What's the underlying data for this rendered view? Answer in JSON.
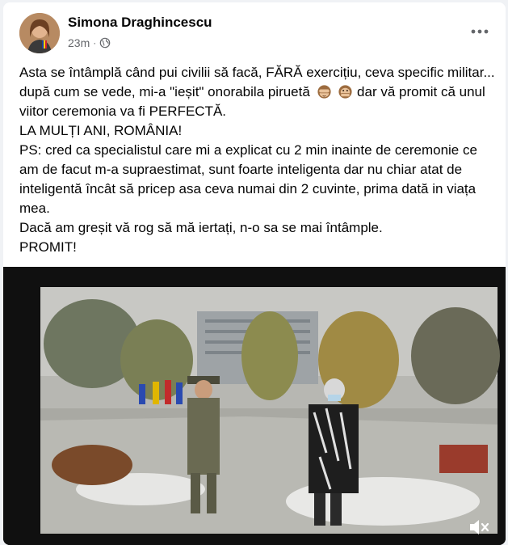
{
  "post": {
    "author": "Simona Draghincescu",
    "time": "23m",
    "separator": "·",
    "paragraphs": [
      {
        "text": "Asta se întâmplă când  pui civilii să facă,   FĂRĂ exercițiu, ceva specific militar... după cum se vede, mi-a \"ieșit\" onorabila piruetă",
        "after": "dar vă promit că  unul viitor ceremonia va fi PERFECTĂ."
      },
      {
        "text": "LA MULȚI ANI, ROMÂNIA!"
      },
      {
        "text": "PS: cred ca specialistul care mi a explicat cu 2 min inainte de ceremonie ce am de facut m-a supraestimat, sunt foarte inteligenta dar nu chiar  atat de inteligentă încât să pricep asa ceva numai din 2 cuvinte, prima dată in viața mea."
      },
      {
        "text": "Dacă am greșit vă rog să mă iertați, n-o sa se mai întâmple."
      },
      {
        "text": "PROMIT!"
      }
    ],
    "emojis": [
      "see-no-evil-monkey-icon",
      "speak-no-evil-monkey-icon"
    ],
    "icons": {
      "privacy": "globe-icon",
      "menu": "more-options-icon",
      "audio": "muted-speaker-icon"
    }
  },
  "colors": {
    "card": "#ffffff",
    "background": "#f0f2f5",
    "secondary_text": "#65676b",
    "video_bg": "#121212"
  }
}
